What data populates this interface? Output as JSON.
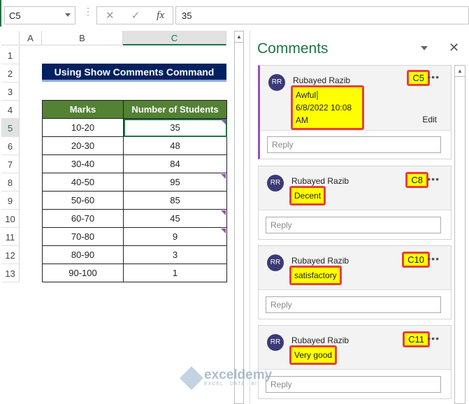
{
  "formula_bar": {
    "name_box": "C5",
    "cancel_icon": "✕",
    "enter_icon": "✓",
    "fx_label": "fx",
    "formula": "35"
  },
  "columns": [
    "A",
    "B",
    "C"
  ],
  "rows": [
    "1",
    "2",
    "3",
    "4",
    "5",
    "6",
    "7",
    "8",
    "9",
    "10",
    "11",
    "12",
    "13"
  ],
  "sheet": {
    "title": "Using Show Comments Command",
    "headers": [
      "Marks",
      "Number of Students"
    ],
    "data": [
      {
        "marks": "10-20",
        "students": "35",
        "comment": true
      },
      {
        "marks": "20-30",
        "students": "48",
        "comment": false
      },
      {
        "marks": "30-40",
        "students": "84",
        "comment": false
      },
      {
        "marks": "40-50",
        "students": "95",
        "comment": true
      },
      {
        "marks": "50-60",
        "students": "85",
        "comment": false
      },
      {
        "marks": "60-70",
        "students": "45",
        "comment": true
      },
      {
        "marks": "70-80",
        "students": "9",
        "comment": true
      },
      {
        "marks": "80-90",
        "students": "3",
        "comment": false
      },
      {
        "marks": "90-100",
        "students": "1",
        "comment": false
      }
    ]
  },
  "comments_pane": {
    "title": "Comments",
    "comments": [
      {
        "initials": "RR",
        "author": "Rubayed Razib",
        "cell": "C5",
        "text": "Awful",
        "timestamp": "6/8/2022 10:08 AM",
        "edit": "Edit",
        "reply_placeholder": "Reply"
      },
      {
        "initials": "RR",
        "author": "Rubayed Razib",
        "cell": "C8",
        "text": "Decent",
        "reply_placeholder": "Reply"
      },
      {
        "initials": "RR",
        "author": "Rubayed Razib",
        "cell": "C10",
        "text": "satisfactory",
        "reply_placeholder": "Reply"
      },
      {
        "initials": "RR",
        "author": "Rubayed Razib",
        "cell": "C11",
        "text": "Very good",
        "reply_placeholder": "Reply"
      }
    ]
  },
  "watermark": {
    "name": "exceldemy",
    "tagline": "EXCEL · DATA · BI"
  },
  "colors": {
    "excel_green": "#217346",
    "title_bg": "#002060",
    "header_bg": "#548235",
    "comment_indicator": "#9b4fb4",
    "highlight": "#ffff00",
    "highlight_border": "#e8403a"
  }
}
